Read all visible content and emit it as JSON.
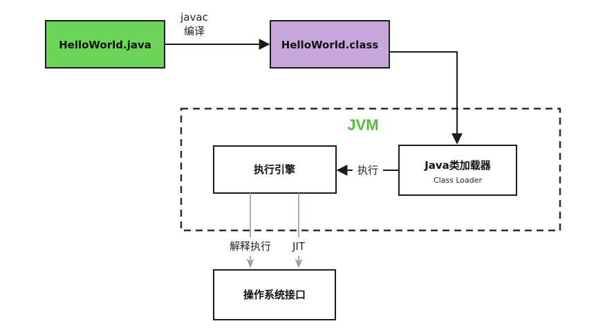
{
  "nodes": {
    "hello_java": {
      "label": "HelloWorld.java",
      "fill": "#6dd65a"
    },
    "hello_class": {
      "label": "HelloWorld.class",
      "fill": "#c8a8dc"
    },
    "class_loader": {
      "label": "Java类加载器",
      "sublabel": "Class Loader"
    },
    "exec_engine": {
      "label": "执行引擎"
    },
    "os_interface": {
      "label": "操作系统接口"
    }
  },
  "jvm": {
    "label": "JVM",
    "color": "#4cbf3a"
  },
  "edges": {
    "compile": {
      "line1": "javac",
      "line2": "编译"
    },
    "execute": {
      "label": "执行"
    },
    "interpret": {
      "label": "解释执行"
    },
    "jit": {
      "label": "JIT"
    }
  },
  "colors": {
    "stroke": "#1a1a1a",
    "faint_arrow": "#a8b0a0"
  }
}
